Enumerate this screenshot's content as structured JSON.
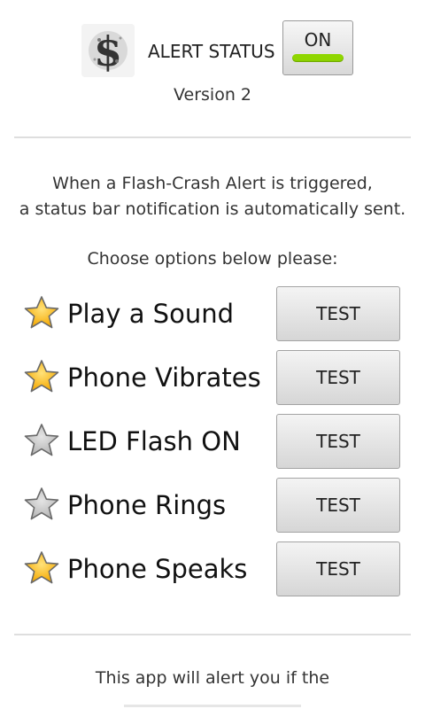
{
  "header": {
    "logo_icon": "dollar-sign-logo",
    "alert_status_label": "ALERT STATUS",
    "toggle_label": "ON",
    "toggle_indicator_color": "#8fd600",
    "version": "Version 2"
  },
  "intro": {
    "line1": "When a Flash-Crash Alert is triggered,",
    "line2": "a status bar notification is automatically sent."
  },
  "choose_prompt": "Choose options below please:",
  "options": [
    {
      "label": "Play a Sound",
      "starred": true,
      "button": "TEST"
    },
    {
      "label": "Phone Vibrates",
      "starred": true,
      "button": "TEST"
    },
    {
      "label": "LED Flash ON",
      "starred": false,
      "button": "TEST"
    },
    {
      "label": "Phone Rings",
      "starred": false,
      "button": "TEST"
    },
    {
      "label": "Phone Speaks",
      "starred": true,
      "button": "TEST"
    }
  ],
  "colors": {
    "star_on": "#f5a800",
    "star_off": "#b5b5b5"
  },
  "footer": {
    "text": "This app will alert you if the"
  }
}
